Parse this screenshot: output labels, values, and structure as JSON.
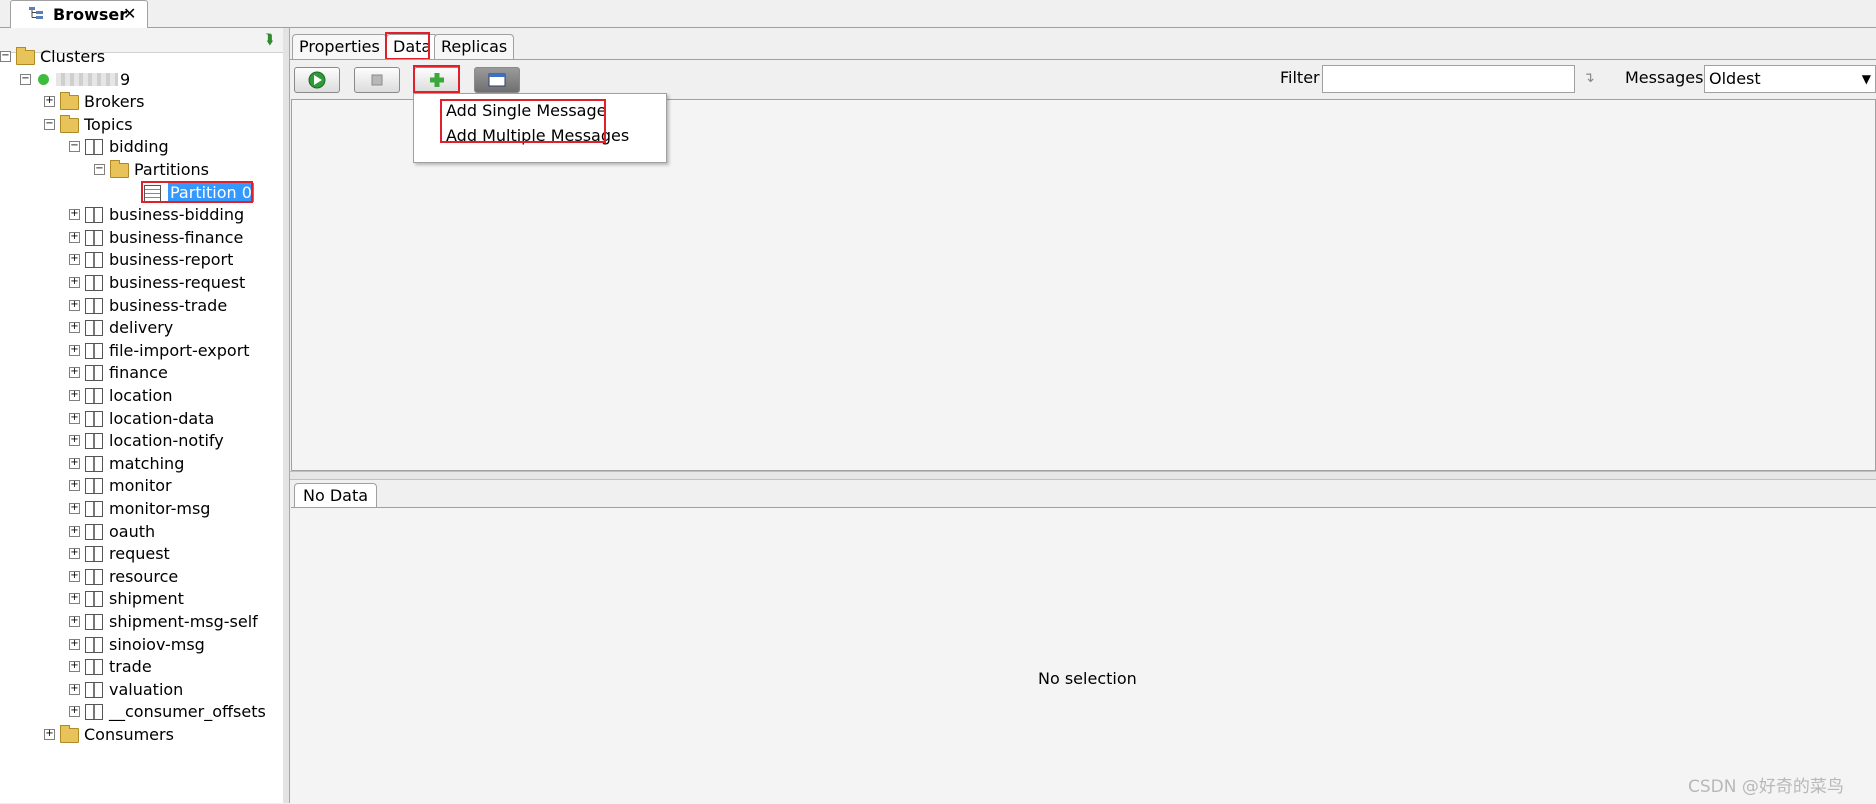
{
  "window": {
    "tab_label": "Browser",
    "close_glyph": "✕"
  },
  "tree": {
    "root_label": "Clusters",
    "cluster_label": "9",
    "brokers_label": "Brokers",
    "topics_label": "Topics",
    "bidding_label": "bidding",
    "partitions_label": "Partitions",
    "partition_label": "Partition 0",
    "topics": [
      "business-bidding",
      "business-finance",
      "business-report",
      "business-request",
      "business-trade",
      "delivery",
      "file-import-export",
      "finance",
      "location",
      "location-data",
      "location-notify",
      "matching",
      "monitor",
      "monitor-msg",
      "oauth",
      "request",
      "resource",
      "shipment",
      "shipment-msg-self",
      "sinoiov-msg",
      "trade",
      "valuation",
      "__consumer_offsets"
    ],
    "consumers_label": "Consumers",
    "expand_glyph": "+",
    "collapse_glyph": "−"
  },
  "tabs": {
    "properties": "Properties",
    "data": "Data",
    "replicas": "Replicas"
  },
  "toolbar": {
    "filter_label": "Filter",
    "filter_value": "",
    "messages_label": "Messages",
    "messages_value": "Oldest"
  },
  "menu": {
    "add_single": "Add Single Message",
    "add_multiple": "Add Multiple Messages"
  },
  "detail": {
    "tab_label": "No Data",
    "empty_text": "No selection"
  },
  "watermark": "CSDN @好奇的菜鸟",
  "colors": {
    "selection": "#3399ff",
    "highlight_box": "#e0202a",
    "status_ok": "#3dbd3d"
  }
}
